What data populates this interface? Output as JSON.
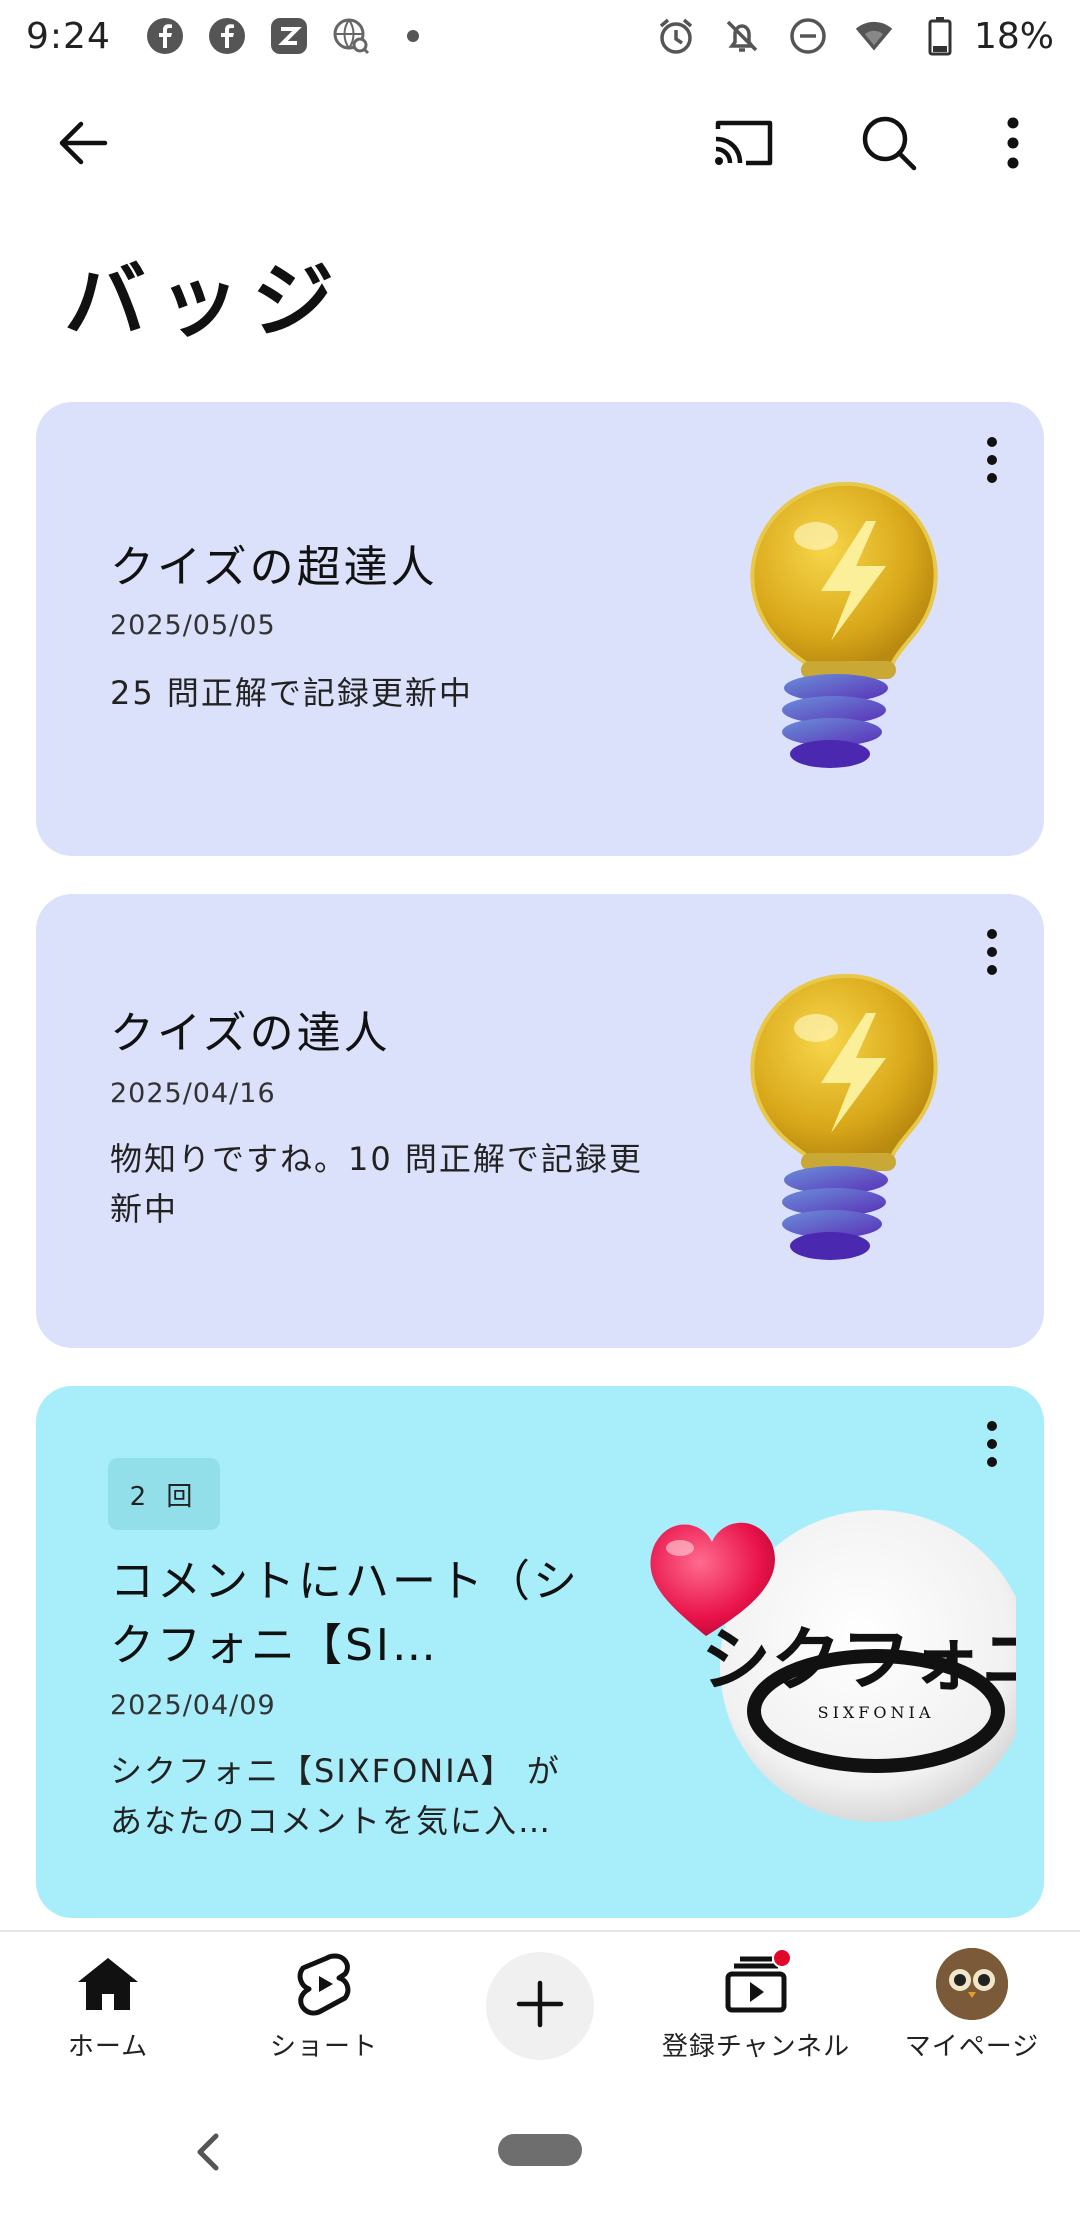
{
  "status_bar": {
    "time": "9:24",
    "battery_percent": "18%",
    "left_icons": [
      "facebook-icon",
      "facebook-icon",
      "zalo-icon",
      "globe-search-icon",
      "dot-icon"
    ],
    "right_icons": [
      "alarm-icon",
      "notifications-off-icon",
      "dnd-icon",
      "wifi-signal-icon",
      "battery-icon"
    ]
  },
  "app_bar": {
    "icons": [
      "back-arrow-icon",
      "cast-icon",
      "search-icon",
      "more-vert-icon"
    ]
  },
  "page": {
    "title": "バッジ"
  },
  "cards": [
    {
      "title": "クイズの超達人",
      "date": "2025/05/05",
      "description": "25 問正解で記録更新中",
      "badge": "lightbulb-badge",
      "background": "#dbe1fa"
    },
    {
      "title": "クイズの達人",
      "date": "2025/04/16",
      "description": "物知りですね。10 問正解で記録更新中",
      "badge": "lightbulb-badge",
      "background": "#dbe1fa"
    },
    {
      "count": "2 回",
      "title": "コメントにハート（シクフォニ【SI…",
      "date": "2025/04/09",
      "description": "シクフォニ【SIXFONIA】 があなたのコメントを気に入…",
      "badge": "heart-channel-badge",
      "logo_text": "シクフォニ",
      "logo_sub": "SIXFONIA",
      "background": "#a7eefa"
    }
  ],
  "bottom_nav": {
    "items": [
      {
        "label": "ホーム",
        "icon": "home-icon"
      },
      {
        "label": "ショート",
        "icon": "shorts-icon"
      },
      {
        "label": "",
        "icon": "create-icon"
      },
      {
        "label": "登録チャンネル",
        "icon": "subscriptions-icon"
      },
      {
        "label": "マイページ",
        "icon": "avatar"
      }
    ]
  },
  "colors": {
    "card_lavender": "#dbe1fa",
    "card_cyan": "#a7eefa",
    "notification_dot": "#e2062a"
  }
}
